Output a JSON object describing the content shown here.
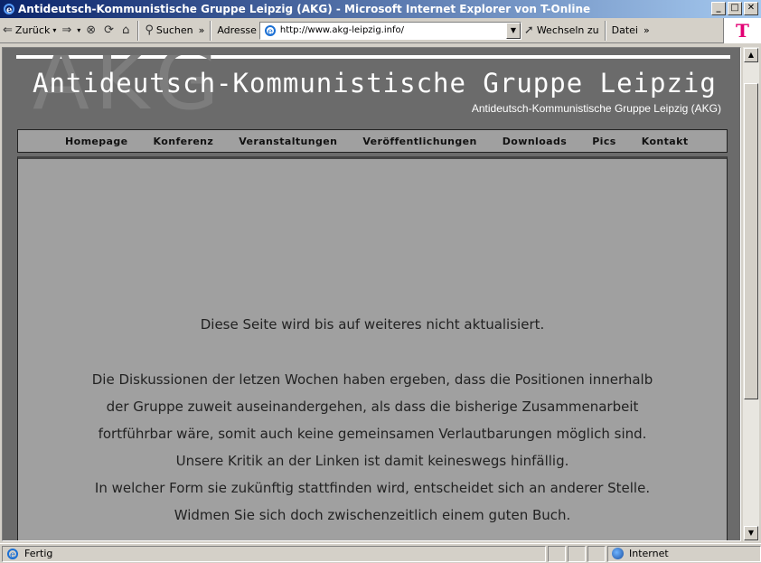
{
  "window": {
    "title": "Antideutsch-Kommunistische Gruppe Leipzig (AKG) - Microsoft Internet Explorer von T-Online",
    "min_label": "_",
    "max_label": "□",
    "close_label": "✕"
  },
  "toolbar": {
    "back_label": "Zurück",
    "search_label": "Suchen",
    "address_label": "Adresse",
    "url": "http://www.akg-leipzig.info/",
    "go_label": "Wechseln zu",
    "file_menu_label": "Datei",
    "chevron": "»",
    "brand_logo": "T"
  },
  "site": {
    "watermark": "AKG",
    "title": "Antideutsch-Kommunistische Gruppe Leipzig",
    "subtitle": "Antideutsch-Kommunistische Gruppe Leipzig (AKG)",
    "nav": [
      "Homepage",
      "Konferenz",
      "Veranstaltungen",
      "Veröffentlichungen",
      "Downloads",
      "Pics",
      "Kontakt"
    ]
  },
  "content": {
    "notice": "Diese Seite wird bis auf weiteres nicht aktualisiert.",
    "lines": [
      "Die Diskussionen der letzen Wochen haben ergeben, dass die Positionen innerhalb",
      "der Gruppe zuweit auseinandergehen, als dass die bisherige Zusammenarbeit",
      "fortführbar wäre, somit auch keine gemeinsamen Verlautbarungen möglich sind.",
      "Unsere Kritik an der Linken ist damit keineswegs hinfällig.",
      "In welcher Form sie zukünftig stattfinden wird, entscheidet sich an anderer Stelle.",
      "Widmen Sie sich doch zwischenzeitlich einem guten Buch."
    ]
  },
  "statusbar": {
    "status": "Fertig",
    "zone": "Internet"
  },
  "colors": {
    "titlebar_start": "#0a246a",
    "titlebar_end": "#a6caf0",
    "page_bg": "#6b6b6b",
    "panel_bg": "#a0a0a0",
    "brand_magenta": "#e20074"
  }
}
